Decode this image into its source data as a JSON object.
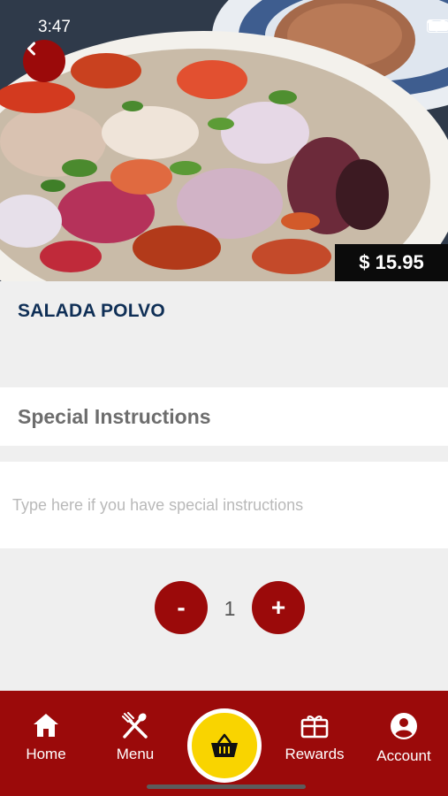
{
  "status_bar": {
    "time": "3:47"
  },
  "item": {
    "title": "SALADA POLVO",
    "price": "$ 15.95"
  },
  "special_instructions": {
    "heading": "Special Instructions",
    "placeholder": "Type here if you have special instructions"
  },
  "quantity": {
    "minus_label": "-",
    "value": "1",
    "plus_label": "+"
  },
  "bottom_nav": {
    "items": [
      {
        "label": "Home",
        "icon": "home-icon"
      },
      {
        "label": "Menu",
        "icon": "fork-spoon-icon"
      },
      {
        "label": "Rewards",
        "icon": "gift-card-icon"
      },
      {
        "label": "Account",
        "icon": "account-icon"
      }
    ],
    "cart_icon": "basket-icon"
  },
  "colors": {
    "brand_red": "#9b0a0a",
    "cart_yellow": "#f9d400",
    "title_navy": "#0f2f56"
  }
}
